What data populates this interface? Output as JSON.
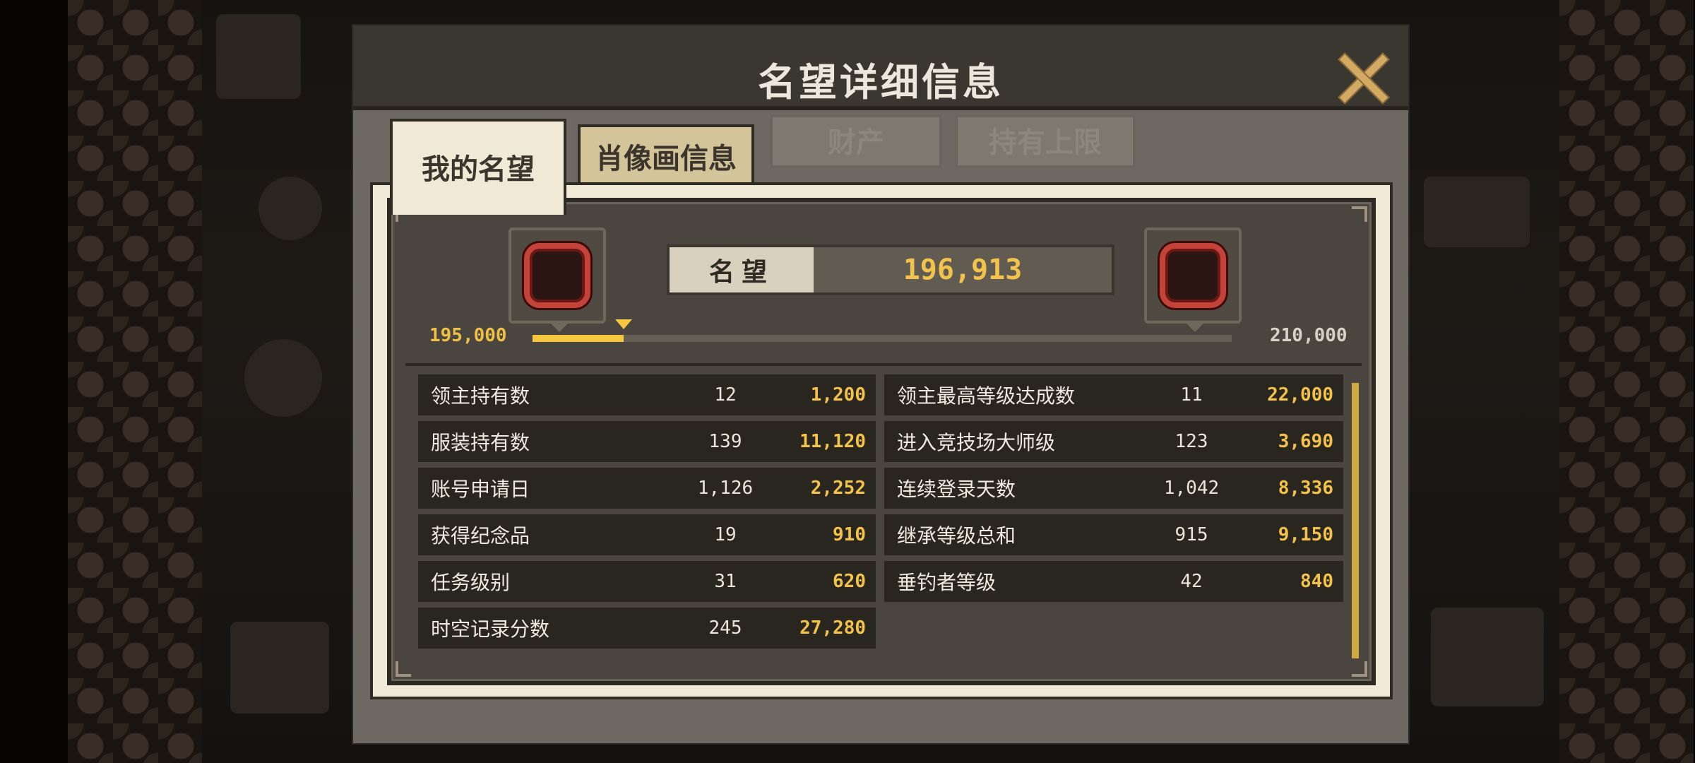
{
  "dialog": {
    "title": "名望详细信息",
    "close_icon": "close-icon"
  },
  "tabs": [
    {
      "label": "我的名望",
      "state": "active"
    },
    {
      "label": "肖像画信息",
      "state": "normal"
    },
    {
      "label": "财产",
      "state": "disabled"
    },
    {
      "label": "持有上限",
      "state": "disabled"
    }
  ],
  "reputation": {
    "label": "名望",
    "value": "196,913",
    "range_min": "195,000",
    "range_max": "210,000",
    "progress_fraction": 0.13,
    "left_badge_icon": "rank-badge-icon",
    "right_badge_icon": "rank-badge-icon"
  },
  "stats": {
    "left": [
      {
        "label": "领主持有数",
        "count": "12",
        "points": "1,200"
      },
      {
        "label": "服装持有数",
        "count": "139",
        "points": "11,120"
      },
      {
        "label": "账号申请日",
        "count": "1,126",
        "points": "2,252"
      },
      {
        "label": "获得纪念品",
        "count": "19",
        "points": "910"
      },
      {
        "label": "任务级别",
        "count": "31",
        "points": "620"
      },
      {
        "label": "时空记录分数",
        "count": "245",
        "points": "27,280"
      }
    ],
    "right": [
      {
        "label": "领主最高等级达成数",
        "count": "11",
        "points": "22,000"
      },
      {
        "label": "进入竞技场大师级",
        "count": "123",
        "points": "3,690"
      },
      {
        "label": "连续登录天数",
        "count": "1,042",
        "points": "8,336"
      },
      {
        "label": "继承等级总和",
        "count": "915",
        "points": "9,150"
      },
      {
        "label": "垂钓者等级",
        "count": "42",
        "points": "840"
      }
    ]
  },
  "colors": {
    "accent_gold": "#f2c24a",
    "badge_red": "#c3423a",
    "panel_dark": "#29251f"
  }
}
